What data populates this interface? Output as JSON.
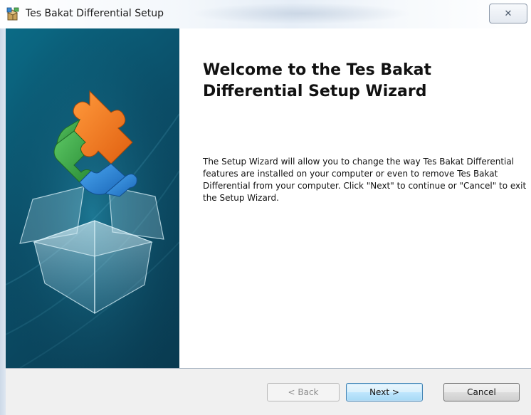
{
  "window": {
    "title": "Tes Bakat Differential Setup",
    "close_symbol": "✕"
  },
  "icons": {
    "app": "installer-box-icon",
    "close": "close-icon",
    "banner": "puzzle-box-graphic"
  },
  "content": {
    "heading": "Welcome to the Tes Bakat Differential Setup Wizard",
    "body": "The Setup Wizard will allow you to change the way Tes Bakat Differential features are installed on your computer or even to remove Tes Bakat Differential from your computer.  Click \"Next\" to continue or \"Cancel\" to exit the Setup Wizard."
  },
  "footer": {
    "back_label": "< Back",
    "next_label": "Next >",
    "cancel_label": "Cancel",
    "back_enabled": false
  },
  "colors": {
    "banner": "#0b4e68",
    "next_button": "#bee6fd",
    "puzzle_orange": "#f07a1e",
    "puzzle_green": "#3da94a",
    "puzzle_blue": "#2a86d6"
  }
}
